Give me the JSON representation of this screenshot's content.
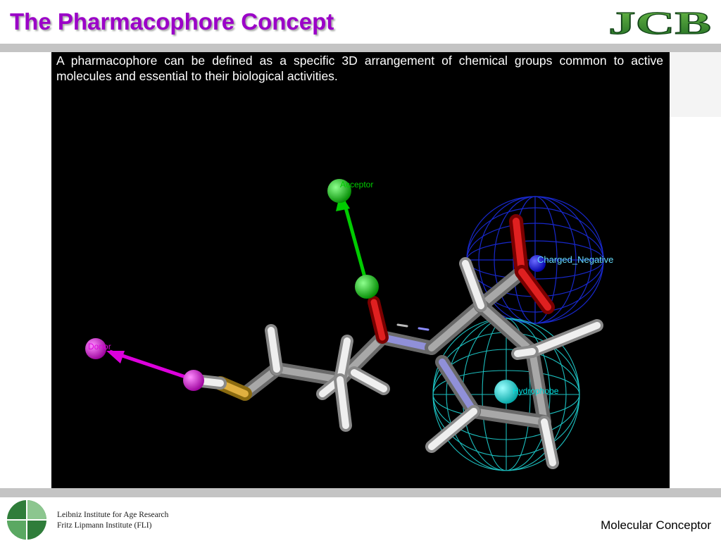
{
  "header": {
    "title": "The Pharmacophore Concept",
    "logo_text": "JCB"
  },
  "main": {
    "intro_text": "A pharmacophore can be defined as a specific 3D arrangement of chemical groups common to active molecules and essential to their biological activities.",
    "features": [
      {
        "label": "Acceptor",
        "color": "#00cc00"
      },
      {
        "label": "Donor",
        "color": "#cc00cc"
      },
      {
        "label": "Charged_Negative",
        "color": "#1a1aff"
      },
      {
        "label": "Hydrophobe",
        "color": "#00cccc"
      }
    ]
  },
  "footer": {
    "institute_line1": "Leibniz Institute for Age Research",
    "institute_line2": "Fritz Lipmann Institute (FLI)",
    "label": "Molecular Conceptor"
  },
  "colors": {
    "title": "#9b00c8",
    "logo_green": "#2e7d32",
    "band_gray": "#c4c4c4",
    "canvas_bg": "#000000"
  }
}
